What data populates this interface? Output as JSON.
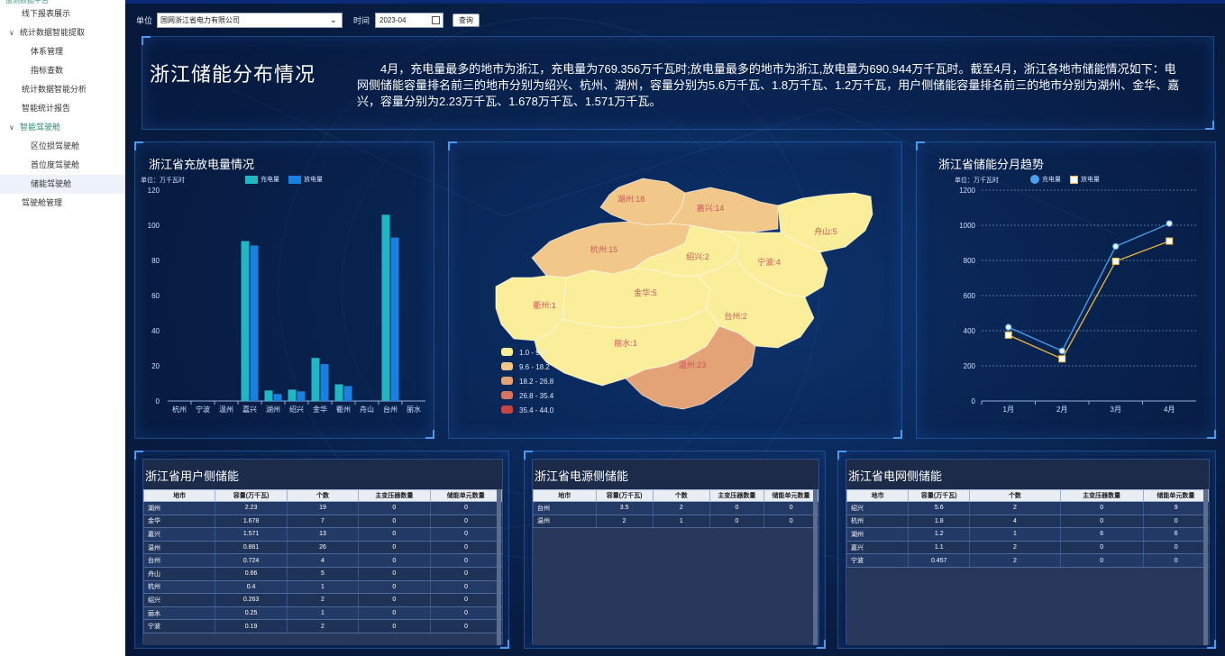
{
  "sidebar": {
    "top_partial": "监测数据平台",
    "items": [
      {
        "label": "线下报表展示",
        "level": 1
      },
      {
        "label": "统计数据智能提取",
        "level": 0,
        "caret": "∨"
      },
      {
        "label": "体系管理",
        "level": 2
      },
      {
        "label": "指标查数",
        "level": 2
      },
      {
        "label": "统计数据智能分析",
        "level": 1
      },
      {
        "label": "智能统计报告",
        "level": 1
      },
      {
        "label": "智能驾驶舱",
        "level": 0,
        "caret": "∨",
        "open": true
      },
      {
        "label": "区位损驾驶舱",
        "level": 2
      },
      {
        "label": "首位度驾驶舱",
        "level": 2
      },
      {
        "label": "储能驾驶舱",
        "level": 2,
        "active": true
      },
      {
        "label": "驾驶舱管理",
        "level": 1
      }
    ]
  },
  "filters": {
    "unit_label": "单位",
    "unit_value": "国网浙江省电力有限公司",
    "time_label": "时间",
    "time_value": "2023-04",
    "query_label": "查询"
  },
  "summary": {
    "title": "浙江储能分布情况",
    "text": "4月，充电量最多的地市为浙江，充电量为769.356万千瓦时;放电量最多的地市为浙江,放电量为690.944万千瓦时。截至4月，浙江各地市储能情况如下：电网侧储能容量排名前三的地市分别为绍兴、杭州、湖州，容量分别为5.6万千瓦、1.8万千瓦、1.2万千瓦，用户侧储能容量排名前三的地市分别为湖州、金华、嘉兴，容量分别为2.23万千瓦、1.678万千瓦、1.571万千瓦。"
  },
  "bar_panel": {
    "title": "浙江省充放电量情况",
    "unit": "单位：万千瓦时",
    "colors": {
      "charge": "#1fb7c4",
      "discharge": "#1a80e0"
    }
  },
  "map_panel": {
    "regions": [
      {
        "name": "湖州",
        "value": 18
      },
      {
        "name": "嘉兴",
        "value": 14
      },
      {
        "name": "舟山",
        "value": 5
      },
      {
        "name": "杭州",
        "value": 15
      },
      {
        "name": "绍兴",
        "value": 2
      },
      {
        "name": "宁波",
        "value": 4
      },
      {
        "name": "衢州",
        "value": 1
      },
      {
        "name": "金华",
        "value": 5
      },
      {
        "name": "台州",
        "value": 2
      },
      {
        "name": "丽水",
        "value": 1
      },
      {
        "name": "温州",
        "value": 23
      }
    ],
    "legend": [
      {
        "label": "1.0 - 9.6",
        "color": "#fbee9a"
      },
      {
        "label": "9.6 - 18.2",
        "color": "#f1c889"
      },
      {
        "label": "18.2 - 26.8",
        "color": "#e4a277"
      },
      {
        "label": "26.8 - 35.4",
        "color": "#d87560"
      },
      {
        "label": "35.4 - 44.0",
        "color": "#c94545"
      }
    ]
  },
  "line_panel": {
    "title": "浙江省储能分月趋势",
    "unit": "单位：万千瓦时",
    "colors": {
      "charge": "#4aa0ee",
      "discharge": "#f0b83a"
    }
  },
  "chart_data": [
    {
      "type": "bar",
      "title": "浙江省充放电量情况",
      "ylabel": "单位：万千瓦时",
      "ylim": [
        0,
        120
      ],
      "yticks": [
        0,
        20,
        40,
        60,
        80,
        100,
        120
      ],
      "categories": [
        "杭州",
        "宁波",
        "温州",
        "嘉兴",
        "湖州",
        "绍兴",
        "金华",
        "衢州",
        "舟山",
        "台州",
        "丽水"
      ],
      "series": [
        {
          "name": "充电量",
          "values": [
            0,
            0,
            0,
            91,
            6,
            6.5,
            24.5,
            9.5,
            0,
            106,
            0
          ]
        },
        {
          "name": "放电量",
          "values": [
            0,
            0,
            0,
            88.5,
            4,
            5.5,
            21,
            8.5,
            0,
            93,
            0
          ]
        }
      ]
    },
    {
      "type": "line",
      "title": "浙江省储能分月趋势",
      "ylabel": "单位：万千瓦时",
      "ylim": [
        0,
        1200
      ],
      "yticks": [
        0,
        200,
        400,
        600,
        800,
        1000,
        1200
      ],
      "categories": [
        "1月",
        "2月",
        "3月",
        "4月"
      ],
      "series": [
        {
          "name": "充电量",
          "values": [
            420,
            285,
            880,
            1010
          ]
        },
        {
          "name": "放电量",
          "values": [
            375,
            240,
            795,
            910
          ]
        }
      ]
    }
  ],
  "user_table": {
    "title": "浙江省用户侧储能",
    "headers": [
      "地市",
      "容量(万千瓦)",
      "个数",
      "主变压器数量",
      "储能单元数量"
    ],
    "rows": [
      [
        "湖州",
        "2.23",
        "19",
        "0",
        "0"
      ],
      [
        "金华",
        "1.678",
        "7",
        "0",
        "0"
      ],
      [
        "嘉兴",
        "1.571",
        "13",
        "0",
        "0"
      ],
      [
        "温州",
        "0.861",
        "26",
        "0",
        "0"
      ],
      [
        "台州",
        "0.724",
        "4",
        "0",
        "0"
      ],
      [
        "舟山",
        "0.66",
        "5",
        "0",
        "0"
      ],
      [
        "杭州",
        "0.4",
        "1",
        "0",
        "0"
      ],
      [
        "绍兴",
        "0.263",
        "2",
        "0",
        "0"
      ],
      [
        "丽水",
        "0.25",
        "1",
        "0",
        "0"
      ],
      [
        "宁波",
        "0.19",
        "2",
        "0",
        "0"
      ]
    ]
  },
  "source_table": {
    "title": "浙江省电源侧储能",
    "headers": [
      "地市",
      "容量(万千瓦)",
      "个数",
      "主变压器数量",
      "储能单元数量"
    ],
    "rows": [
      [
        "台州",
        "3.5",
        "2",
        "0",
        "0"
      ],
      [
        "温州",
        "2",
        "1",
        "0",
        "0"
      ]
    ]
  },
  "grid_table": {
    "title": "浙江省电网侧储能",
    "headers": [
      "地市",
      "容量(万千瓦)",
      "个数",
      "主变压器数量",
      "储能单元数量"
    ],
    "rows": [
      [
        "绍兴",
        "5.6",
        "2",
        "0",
        "9"
      ],
      [
        "杭州",
        "1.8",
        "4",
        "0",
        "0"
      ],
      [
        "湖州",
        "1.2",
        "1",
        "6",
        "6"
      ],
      [
        "嘉兴",
        "1.1",
        "2",
        "0",
        "0"
      ],
      [
        "宁波",
        "0.457",
        "2",
        "0",
        "0"
      ]
    ]
  }
}
